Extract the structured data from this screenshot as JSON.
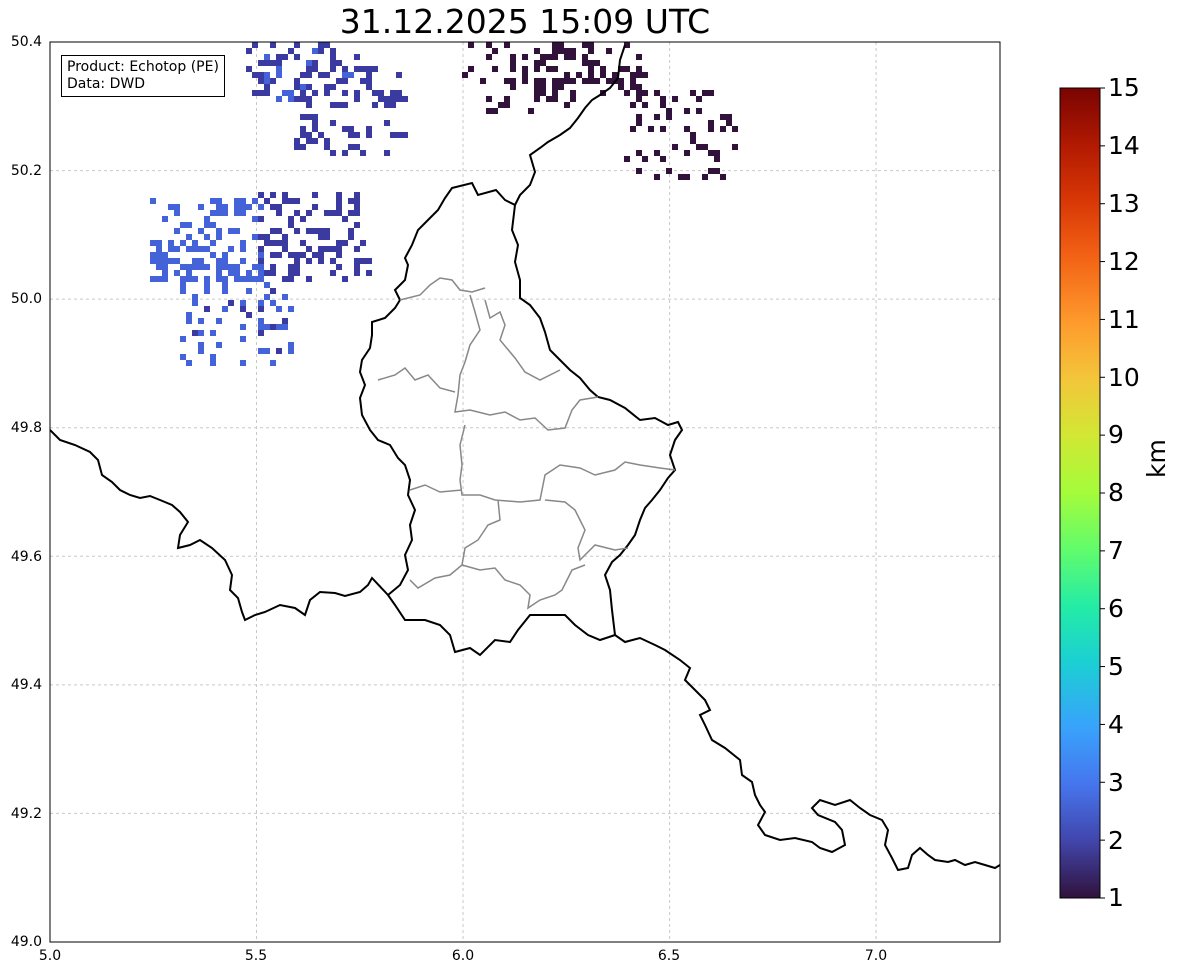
{
  "title": "31.12.2025 15:09 UTC",
  "info": {
    "product": "Product: Echotop (PE)",
    "data": "Data: DWD"
  },
  "map": {
    "lon_range": [
      5.0,
      7.3
    ],
    "lat_range": [
      49.0,
      50.4
    ],
    "grid": true,
    "x_ticks": [
      "5.0",
      "5.5",
      "6.0",
      "6.5",
      "7.0"
    ],
    "y_ticks": [
      "50.4",
      "50.2",
      "50.0",
      "49.8",
      "49.6",
      "49.4",
      "49.2",
      "49.0"
    ]
  },
  "colorbar": {
    "unit": "km",
    "ticks": [
      "15",
      "14",
      "13",
      "12",
      "11",
      "10",
      "9",
      "8",
      "7",
      "6",
      "5",
      "4",
      "3",
      "2",
      "1"
    ],
    "colors": [
      "#30123b",
      "#4145ab",
      "#4675ed",
      "#39a2fc",
      "#1bcfd4",
      "#24eca6",
      "#61fc6c",
      "#a4fc3b",
      "#d1e834",
      "#f3c63a",
      "#fe9b2d",
      "#f36315",
      "#d93806",
      "#b11901",
      "#7a0402"
    ]
  },
  "echoes": {
    "colors": {
      "low": "#30123b",
      "mid": "#3b3aa0",
      "blue": "#4463d8"
    },
    "cells": [
      {
        "lon": 5.6,
        "lat": 50.38,
        "level": 2.2
      },
      {
        "lon": 5.72,
        "lat": 50.3,
        "level": 2.1
      },
      {
        "lon": 5.63,
        "lat": 50.1,
        "level": 2.1
      },
      {
        "lon": 6.13,
        "lat": 50.36,
        "level": 1.2
      },
      {
        "lon": 6.3,
        "lat": 50.39,
        "level": 1.1
      },
      {
        "lon": 6.52,
        "lat": 50.26,
        "level": 1.1
      },
      {
        "lon": 5.45,
        "lat": 49.97,
        "level": 2.4
      },
      {
        "lon": 5.37,
        "lat": 50.09,
        "level": 2.5
      }
    ]
  }
}
